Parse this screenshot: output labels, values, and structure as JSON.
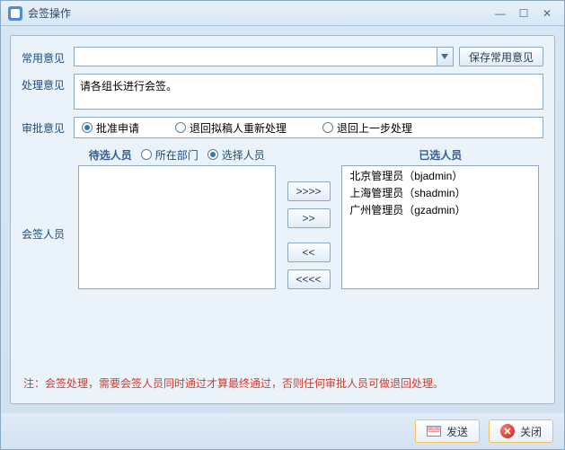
{
  "window": {
    "title": "会签操作",
    "min": "—",
    "max": "☐",
    "close": "✕"
  },
  "labels": {
    "common_opinion": "常用意见",
    "process_opinion": "处理意见",
    "approval_opinion": "审批意见",
    "countersign_people": "会签人员"
  },
  "buttons": {
    "save_common_opinion": "保存常用意见",
    "add_all": ">>>>",
    "add_one": ">>",
    "remove_one": "<<",
    "remove_all": "<<<<",
    "send": "发送",
    "close": "关闭"
  },
  "common_opinion_value": "",
  "process_opinion_value": "请各组长进行会签。",
  "approval_options": [
    {
      "label": "批准申请",
      "checked": true
    },
    {
      "label": "退回拟稿人重新处理",
      "checked": false
    },
    {
      "label": "退回上一步处理",
      "checked": false
    }
  ],
  "selector": {
    "candidate_title": "待选人员",
    "selected_title": "已选人员",
    "filter_options": [
      {
        "label": "所在部门",
        "checked": false
      },
      {
        "label": "选择人员",
        "checked": true
      }
    ],
    "candidate_items": [],
    "selected_items": [
      "北京管理员（bjadmin）",
      "上海管理员（shadmin）",
      "广州管理员（gzadmin）"
    ]
  },
  "note": "注：会签处理，需要会签人员同时通过才算最终通过，否则任何审批人员可做退回处理。"
}
